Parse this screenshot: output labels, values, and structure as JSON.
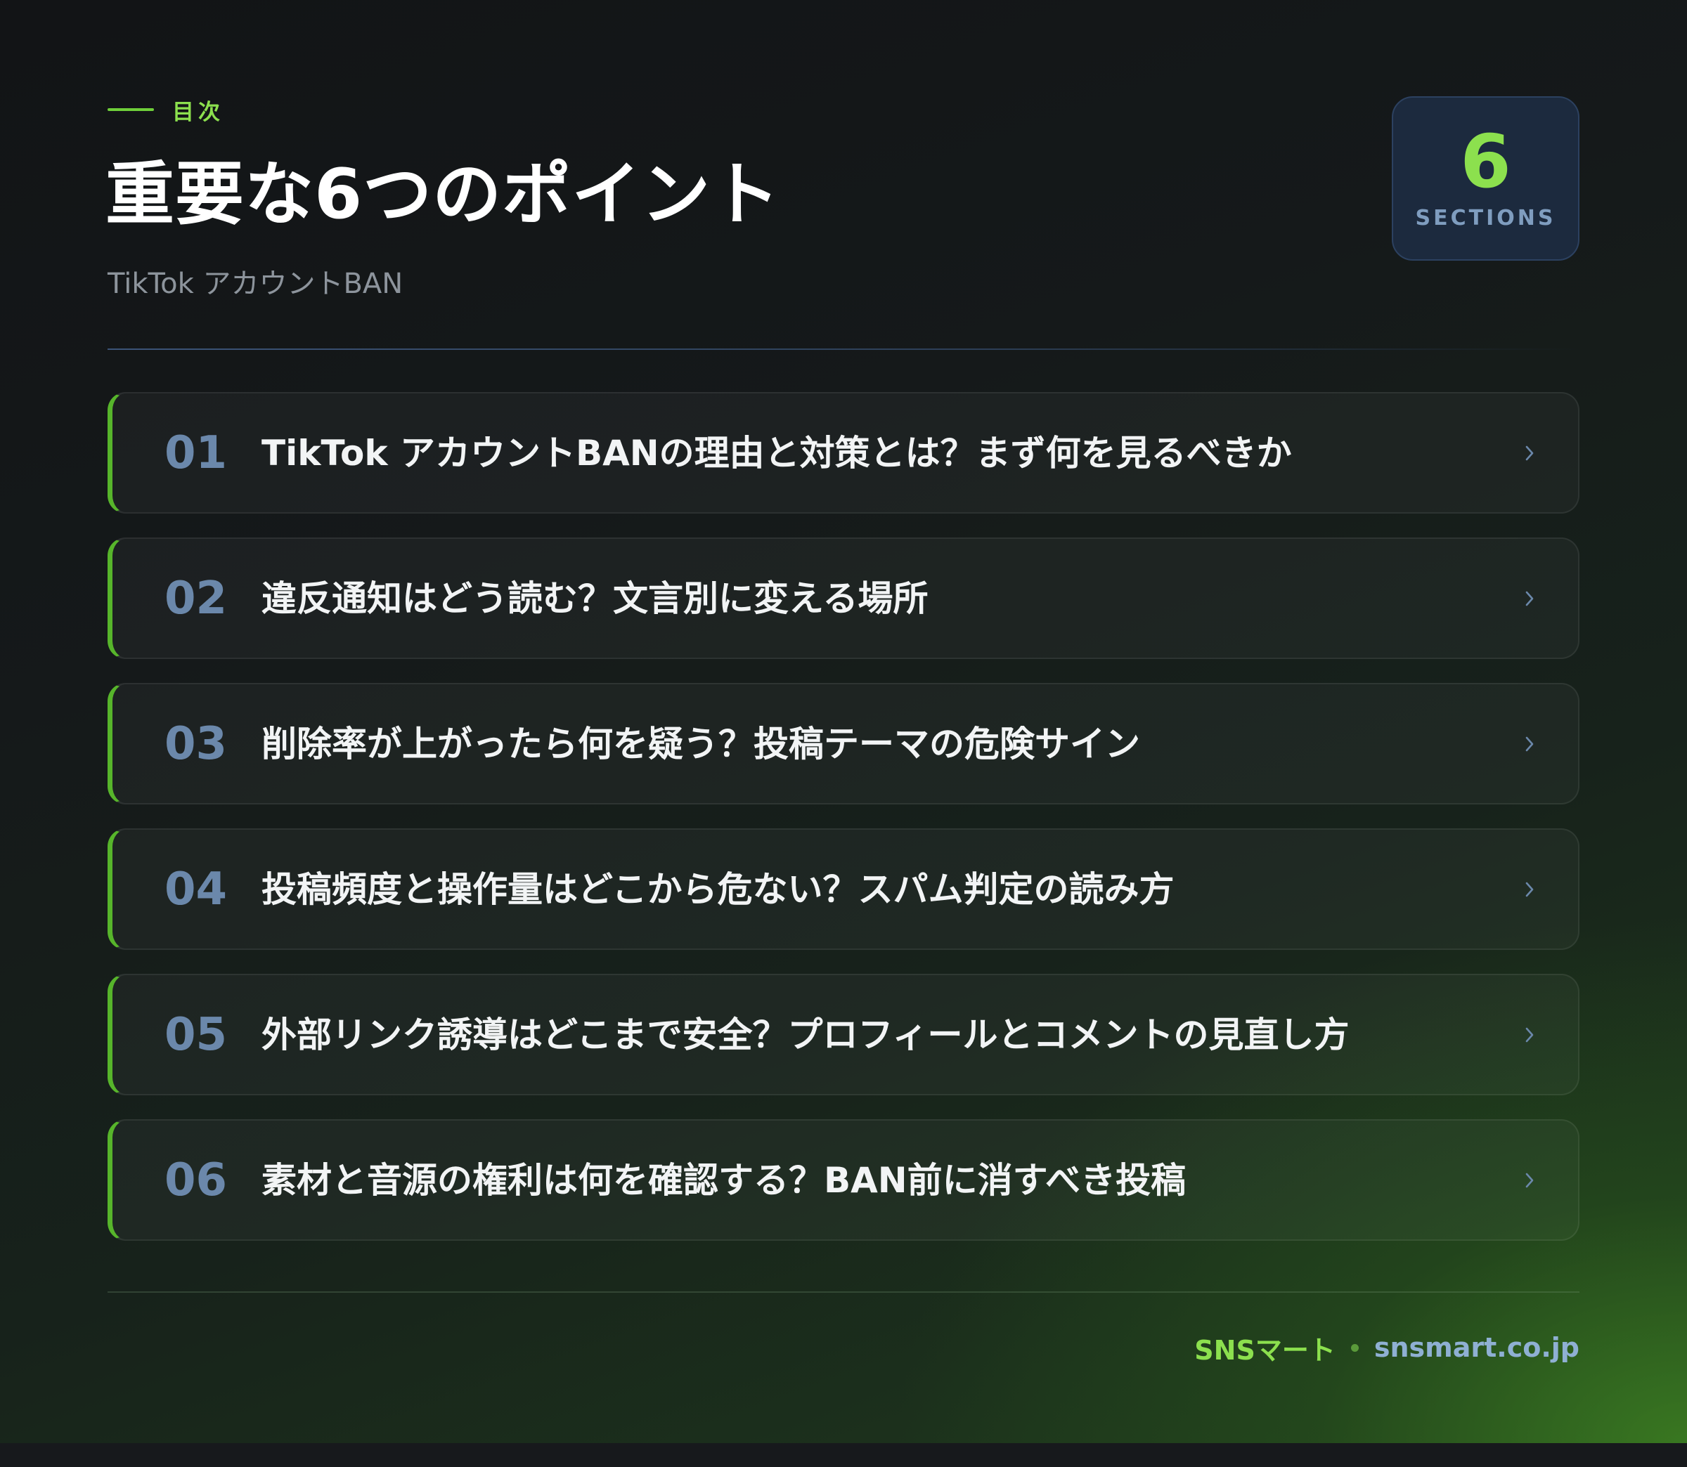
{
  "header": {
    "eyebrow": "目次",
    "title": "重要な6つのポイント",
    "subtitle": "TikTok アカウントBAN"
  },
  "badge": {
    "count": "6",
    "label": "SECTIONS"
  },
  "items": [
    {
      "num": "01",
      "text": "TikTok アカウントBANの理由と対策とは？まず何を見るべきか"
    },
    {
      "num": "02",
      "text": "違反通知はどう読む？文言別に変える場所"
    },
    {
      "num": "03",
      "text": "削除率が上がったら何を疑う？投稿テーマの危険サイン"
    },
    {
      "num": "04",
      "text": "投稿頻度と操作量はどこから危ない？スパム判定の読み方"
    },
    {
      "num": "05",
      "text": "外部リンク誘導はどこまで安全？プロフィールとコメントの見直し方"
    },
    {
      "num": "06",
      "text": "素材と音源の権利は何を確認する？BAN前に消すべき投稿"
    }
  ],
  "footer": {
    "brand": "SNSマート",
    "domain": "snsmart.co.jp"
  },
  "colors": {
    "accent": "#8ce04e",
    "number": "#6b88ab",
    "badge_bg": "#1c2a3e"
  },
  "icons": {
    "chevron": "chevron-right-icon"
  }
}
